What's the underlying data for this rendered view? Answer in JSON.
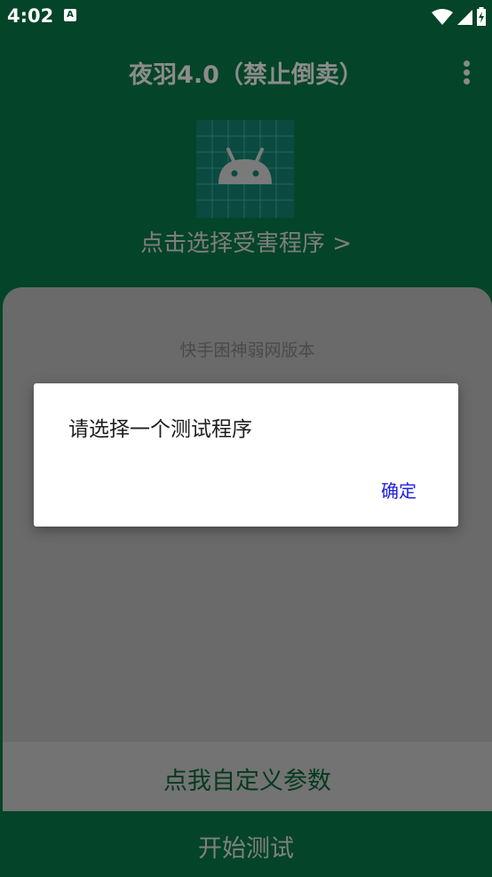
{
  "status_bar": {
    "time": "4:02",
    "notification_glyph": "A",
    "icons": [
      "notification-icon",
      "wifi-icon",
      "signal-icon",
      "battery-charging-icon"
    ]
  },
  "header": {
    "title": "夜羽4.0（禁止倒卖）",
    "menu_icon": "more-vert-icon"
  },
  "app_picker": {
    "icon": "android-icon",
    "label": "点击选择受害程序 >"
  },
  "panel": {
    "version_label": "快手困神弱网版本",
    "custom_params_label": "点我自定义参数"
  },
  "footer": {
    "start_label": "开始测试"
  },
  "dialog": {
    "message": "请选择一个测试程序",
    "ok_label": "确定"
  },
  "colors": {
    "primary_dark": "#044428",
    "panel_gray": "#6a6a6a",
    "dialog_accent": "#2020dd"
  }
}
